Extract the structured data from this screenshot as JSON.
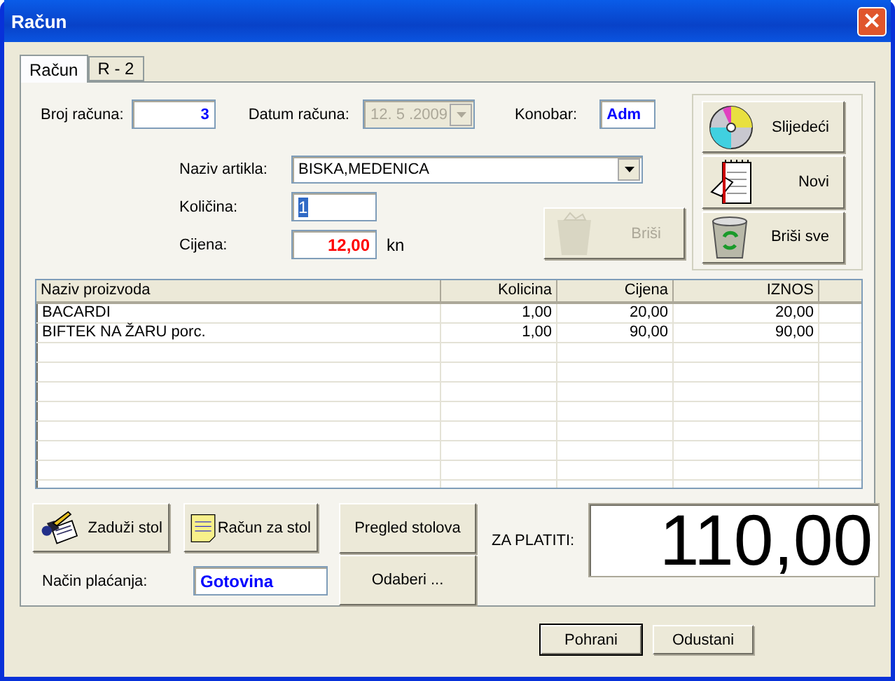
{
  "window": {
    "title": "Račun",
    "close": "×"
  },
  "tabs": [
    {
      "label": "Račun",
      "selected": true
    },
    {
      "label": "R - 2",
      "selected": false
    }
  ],
  "form": {
    "invoice_number": {
      "label": "Broj računa:",
      "value": "3"
    },
    "date": {
      "label": "Datum računa:",
      "value": "12. 5 .2009",
      "disabled": true
    },
    "waiter": {
      "label": "Konobar:",
      "value": "Adm"
    },
    "article": {
      "label": "Naziv artikla:",
      "value": "BISKA,MEDENICA"
    },
    "quantity": {
      "label": "Količina:",
      "value": "1",
      "text_selected": true
    },
    "price": {
      "label": "Cijena:",
      "value": "12,00",
      "unit": "kn"
    },
    "delete_button": {
      "label": "Briši",
      "disabled": true
    }
  },
  "side_buttons": [
    {
      "label": "Slijedeći",
      "kind": "disc"
    },
    {
      "label": "Novi",
      "kind": "notepad"
    },
    {
      "label": "Briši sve",
      "kind": "bin"
    }
  ],
  "table": {
    "columns": [
      "Naziv proizvoda",
      "Kolicina",
      "Cijena",
      "IZNOS"
    ],
    "rows": [
      [
        "BACARDI",
        "1,00",
        "20,00",
        "20,00"
      ],
      [
        "BIFTEK NA ŽARU porc.",
        "1,00",
        "90,00",
        "90,00"
      ]
    ]
  },
  "table_actions": [
    {
      "label": "Zaduži stol",
      "kind": "hand"
    },
    {
      "label": "Račun za stol",
      "kind": "note"
    }
  ],
  "table_views": [
    "Pregled stolova",
    "Odaberi ..."
  ],
  "payment": {
    "label": "Način plaćanja:",
    "value": "Gotovina"
  },
  "total": {
    "label": "ZA PLATITI:",
    "value": "110,00"
  },
  "dialog_buttons": [
    {
      "label": "Pohrani",
      "default": true
    },
    {
      "label": "Odustani",
      "default": false
    }
  ]
}
